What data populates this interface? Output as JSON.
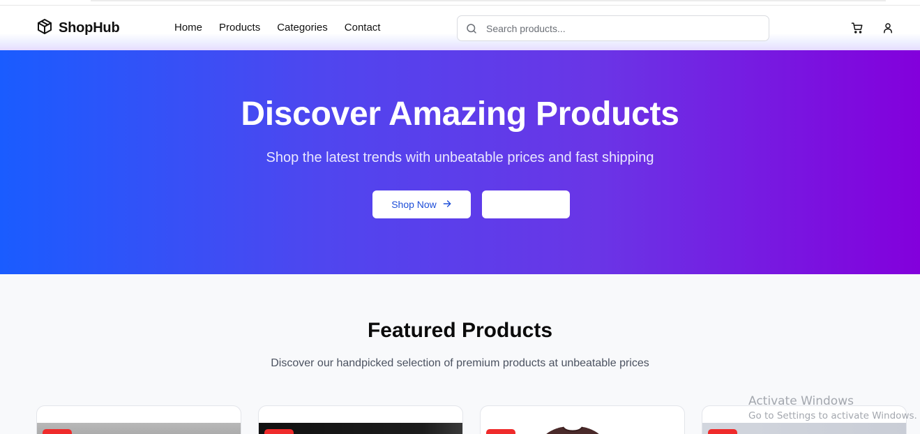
{
  "header": {
    "brand": "ShopHub",
    "nav": [
      "Home",
      "Products",
      "Categories",
      "Contact"
    ],
    "search_placeholder": "Search products..."
  },
  "hero": {
    "title": "Discover Amazing Products",
    "subtitle": "Shop the latest trends with unbeatable prices and fast shipping",
    "primary_button": "Shop Now",
    "secondary_button": "",
    "gradient_start": "#1a5cff",
    "gradient_end": "#8300dc"
  },
  "featured": {
    "title": "Featured Products",
    "subtitle": "Discover our handpicked selection of premium products at unbeatable prices",
    "badge_color": "#ef2b2b"
  },
  "icons": {
    "logo": "package-icon",
    "search": "search-icon",
    "cart": "cart-icon",
    "user": "user-icon",
    "arrow": "arrow-right-icon"
  },
  "watermark": {
    "title": "Activate Windows",
    "subtitle": "Go to Settings to activate Windows."
  }
}
